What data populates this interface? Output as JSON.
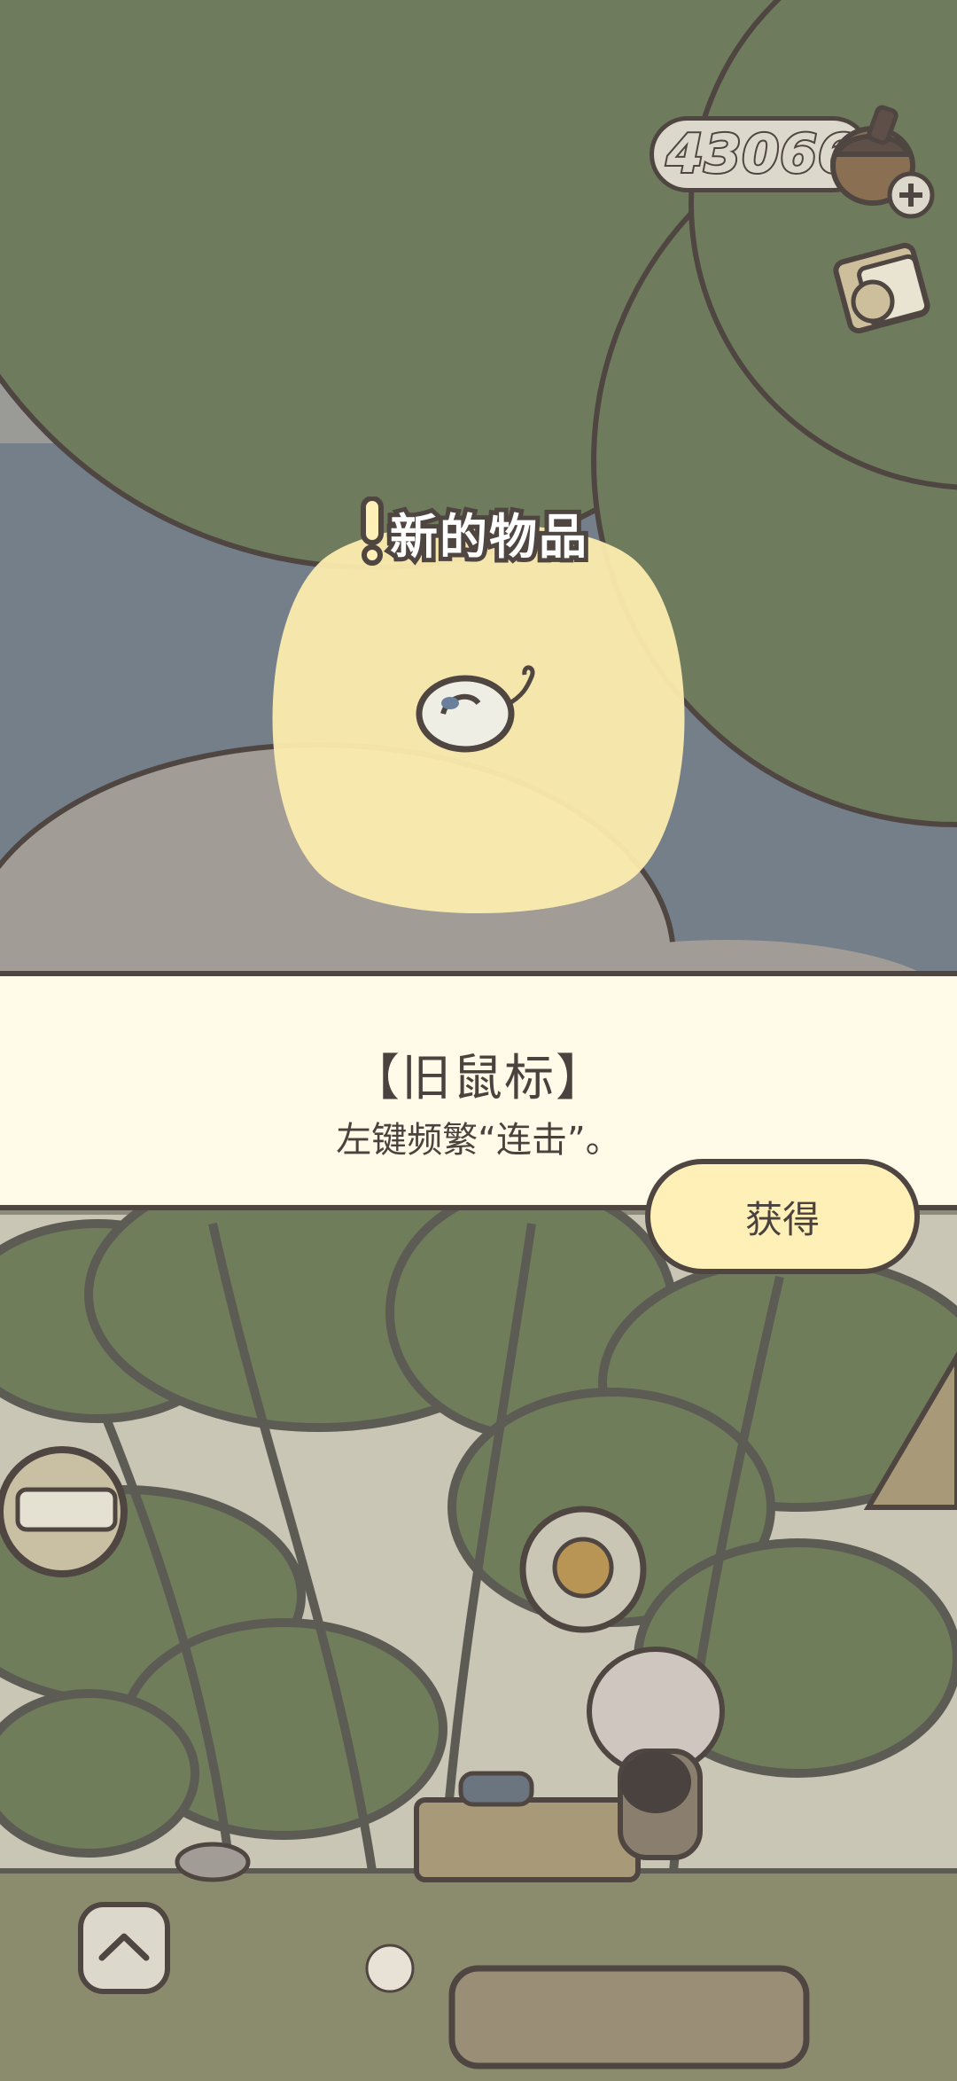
{
  "hud": {
    "currency_amount": "430663",
    "currency_icon": "acorn-icon",
    "add_icon": "plus-icon",
    "scroll_icon": "scroll-icon",
    "expand_icon": "chevron-up-icon"
  },
  "notification": {
    "label": "新的物品",
    "icon": "exclamation-icon",
    "item_icon": "mouse-icon"
  },
  "item_panel": {
    "name": "【旧鼠标】",
    "description": "左键频繁“连击”。",
    "get_button_label": "获得"
  },
  "colors": {
    "tree": "#6f7b5d",
    "sky": "#747f8a",
    "highlight": "#fcecae",
    "panel": "#fffbe8",
    "outline": "#4f4642",
    "button": "#fff0b8"
  }
}
